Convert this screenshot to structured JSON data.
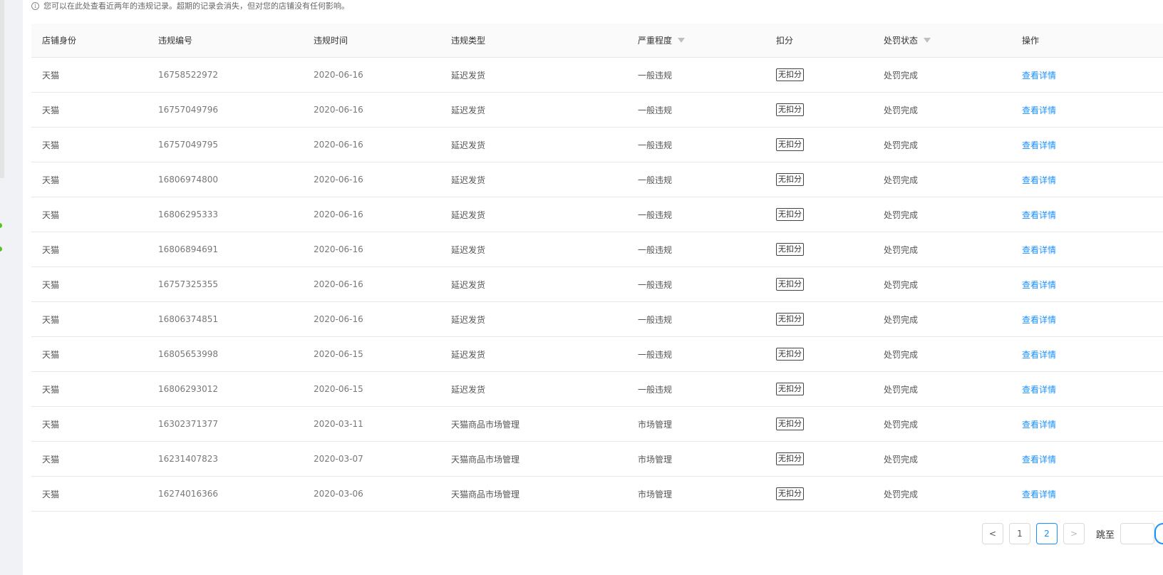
{
  "notice": {
    "text": "您可以在此处查看近两年的违规记录。超期的记录会消失，但对您的店铺没有任何影响。",
    "icon": "info-icon"
  },
  "table": {
    "headers": {
      "shop": "店铺身份",
      "id": "违规编号",
      "time": "违规时间",
      "type": "违规类型",
      "severity": "严重程度",
      "points": "扣分",
      "status": "处罚状态",
      "action": "操作"
    },
    "rows": [
      {
        "shop": "天猫",
        "id": "16758522972",
        "time": "2020-06-16",
        "type": "延迟发货",
        "severity": "一般违规",
        "points": "无扣分",
        "status": "处罚完成",
        "action": "查看详情"
      },
      {
        "shop": "天猫",
        "id": "16757049796",
        "time": "2020-06-16",
        "type": "延迟发货",
        "severity": "一般违规",
        "points": "无扣分",
        "status": "处罚完成",
        "action": "查看详情"
      },
      {
        "shop": "天猫",
        "id": "16757049795",
        "time": "2020-06-16",
        "type": "延迟发货",
        "severity": "一般违规",
        "points": "无扣分",
        "status": "处罚完成",
        "action": "查看详情"
      },
      {
        "shop": "天猫",
        "id": "16806974800",
        "time": "2020-06-16",
        "type": "延迟发货",
        "severity": "一般违规",
        "points": "无扣分",
        "status": "处罚完成",
        "action": "查看详情"
      },
      {
        "shop": "天猫",
        "id": "16806295333",
        "time": "2020-06-16",
        "type": "延迟发货",
        "severity": "一般违规",
        "points": "无扣分",
        "status": "处罚完成",
        "action": "查看详情"
      },
      {
        "shop": "天猫",
        "id": "16806894691",
        "time": "2020-06-16",
        "type": "延迟发货",
        "severity": "一般违规",
        "points": "无扣分",
        "status": "处罚完成",
        "action": "查看详情"
      },
      {
        "shop": "天猫",
        "id": "16757325355",
        "time": "2020-06-16",
        "type": "延迟发货",
        "severity": "一般违规",
        "points": "无扣分",
        "status": "处罚完成",
        "action": "查看详情"
      },
      {
        "shop": "天猫",
        "id": "16806374851",
        "time": "2020-06-16",
        "type": "延迟发货",
        "severity": "一般违规",
        "points": "无扣分",
        "status": "处罚完成",
        "action": "查看详情"
      },
      {
        "shop": "天猫",
        "id": "16805653998",
        "time": "2020-06-15",
        "type": "延迟发货",
        "severity": "一般违规",
        "points": "无扣分",
        "status": "处罚完成",
        "action": "查看详情"
      },
      {
        "shop": "天猫",
        "id": "16806293012",
        "time": "2020-06-15",
        "type": "延迟发货",
        "severity": "一般违规",
        "points": "无扣分",
        "status": "处罚完成",
        "action": "查看详情"
      },
      {
        "shop": "天猫",
        "id": "16302371377",
        "time": "2020-03-11",
        "type": "天猫商品市场管理",
        "severity": "市场管理",
        "points": "无扣分",
        "status": "处罚完成",
        "action": "查看详情"
      },
      {
        "shop": "天猫",
        "id": "16231407823",
        "time": "2020-03-07",
        "type": "天猫商品市场管理",
        "severity": "市场管理",
        "points": "无扣分",
        "status": "处罚完成",
        "action": "查看详情"
      },
      {
        "shop": "天猫",
        "id": "16274016366",
        "time": "2020-03-06",
        "type": "天猫商品市场管理",
        "severity": "市场管理",
        "points": "无扣分",
        "status": "处罚完成",
        "action": "查看详情"
      }
    ]
  },
  "pagination": {
    "prev": "<",
    "pages": [
      "1",
      "2"
    ],
    "current": "2",
    "next": ">",
    "jump_label": "跳至",
    "jump_value": ""
  },
  "colors": {
    "link": "#1890ff",
    "border": "#e8e8e8",
    "header_bg": "#fafafa"
  }
}
